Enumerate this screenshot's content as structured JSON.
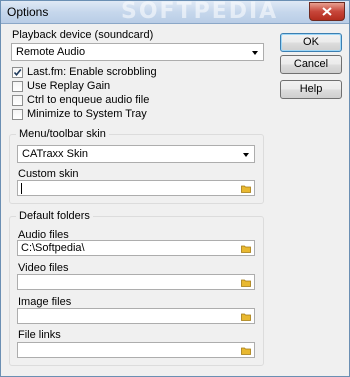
{
  "window": {
    "title": "Options",
    "watermark": "SOFTPEDIA"
  },
  "playback": {
    "label": "Playback device (soundcard)",
    "device": "Remote Audio"
  },
  "options": [
    {
      "label": "Last.fm: Enable scrobbling",
      "checked": true
    },
    {
      "label": "Use Replay Gain",
      "checked": false
    },
    {
      "label": "Ctrl to enqueue audio file",
      "checked": false
    },
    {
      "label": "Minimize to System Tray",
      "checked": false
    }
  ],
  "buttons": {
    "ok": "OK",
    "cancel": "Cancel",
    "help": "Help"
  },
  "skin_group": {
    "title": "Menu/toolbar skin",
    "selected_skin": "CATraxx Skin",
    "custom_label": "Custom skin",
    "custom_value": ""
  },
  "folders_group": {
    "title": "Default folders",
    "audio_label": "Audio files",
    "audio_value": "C:\\Softpedia\\",
    "video_label": "Video files",
    "video_value": "",
    "image_label": "Image files",
    "image_value": "",
    "links_label": "File links",
    "links_value": ""
  },
  "colors": {
    "accent": "#3c7fb1",
    "folder": "#e8b830",
    "close": "#c7463a"
  }
}
